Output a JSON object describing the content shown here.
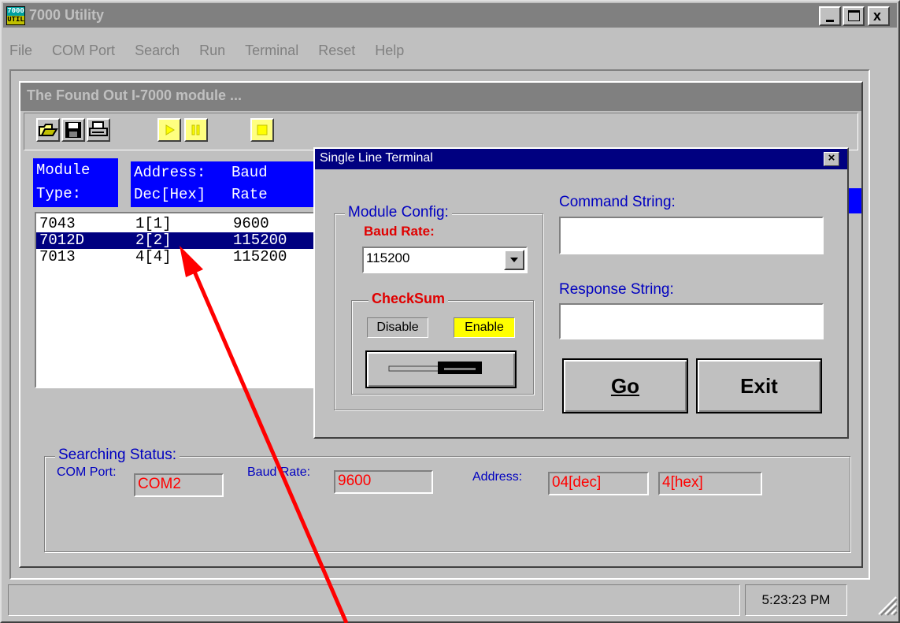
{
  "window": {
    "icon_text": "7000 UTIL",
    "title": "7000 Utility",
    "controls": [
      "_",
      "□",
      "x"
    ]
  },
  "menu": [
    {
      "label": "File"
    },
    {
      "label": "COM Port"
    },
    {
      "label": "Search"
    },
    {
      "label": "Run"
    },
    {
      "label": "Terminal"
    },
    {
      "label": "Reset"
    },
    {
      "label": "Help"
    }
  ],
  "child_window": {
    "title": "The Found Out I-7000 module ..."
  },
  "toolbar": {
    "icons": [
      "open-folder-icon",
      "save-icon",
      "print-icon",
      "play-icon",
      "pause-icon",
      "stop-icon"
    ]
  },
  "table": {
    "headers": {
      "module_line1": "Module",
      "module_line2": "Type:",
      "address_line1": "Address:",
      "address_line2": "Dec[Hex]",
      "baud_line1": "Baud",
      "baud_line2": "Rate"
    },
    "rows": [
      {
        "type": "7043",
        "address": "1[1]",
        "baud": "9600"
      },
      {
        "type": "7012D",
        "address": "2[2]",
        "baud": "115200"
      },
      {
        "type": "7013",
        "address": "4[4]",
        "baud": "115200"
      }
    ],
    "selected_row": 1
  },
  "search_status": {
    "title": "Searching Status:",
    "com_port_label": "COM Port:",
    "com_port_value": "COM2",
    "baud_rate_label": "Baud Rate:",
    "baud_rate_value": "9600",
    "address_label": "Address:",
    "address_dec": "04[dec]",
    "address_hex": "4[hex]"
  },
  "dialog": {
    "title": "Single Line Terminal",
    "close": "×",
    "module_config_label": "Module Config:",
    "baud_rate_label": "Baud Rate:",
    "baud_rate_value": "115200",
    "checksum_label": "CheckSum",
    "disable_label": "Disable",
    "enable_label": "Enable",
    "command_label": "Command String:",
    "command_value": "",
    "response_label": "Response String:",
    "response_value": "",
    "go_label": "Go",
    "exit_label": "Exit"
  },
  "statusbar": {
    "time": "5:23:23 PM"
  },
  "colors": {
    "title_bar": "#808080",
    "dialog_title": "#000080",
    "selection": "#000080",
    "header_blue": "#0000ff",
    "annotation_arrow": "#ff0000",
    "field_text": "#ff0000"
  }
}
